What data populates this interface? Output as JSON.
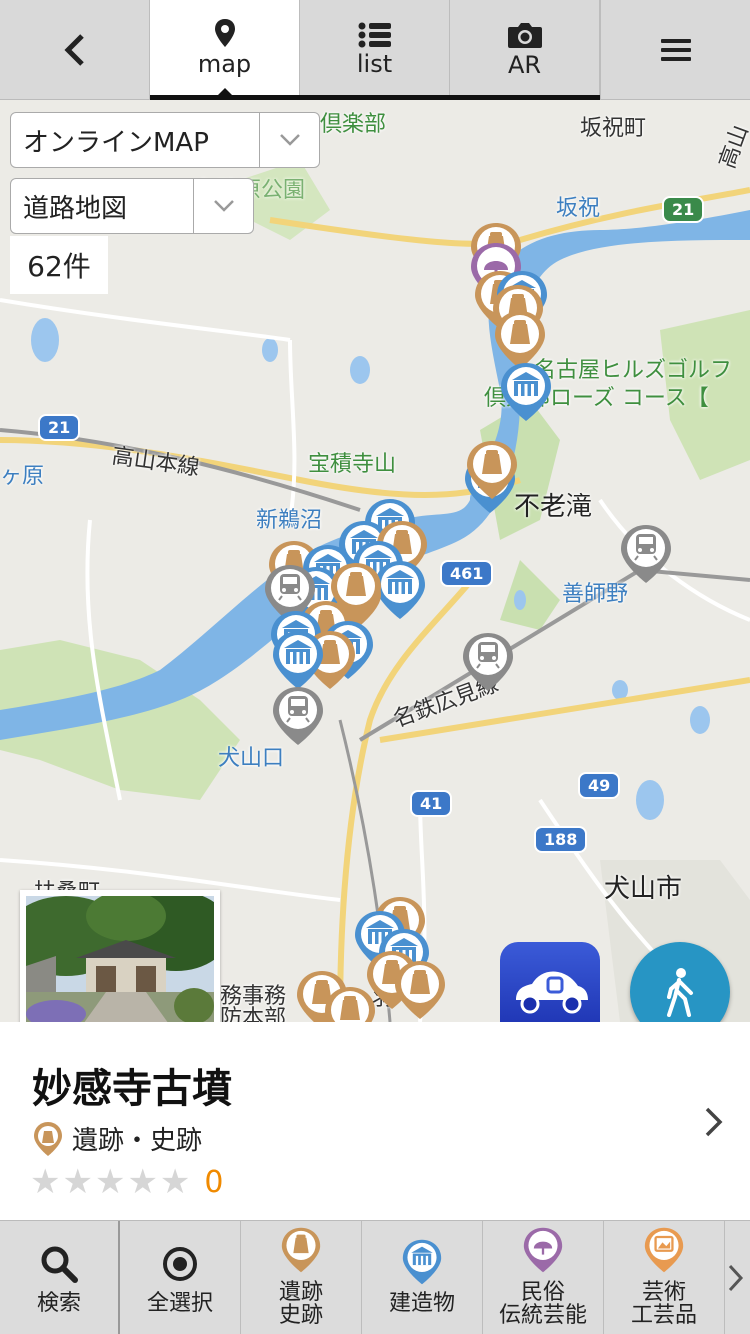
{
  "topbar": {
    "back_icon": "chevron-left-icon",
    "tabs": [
      {
        "label": "map",
        "icon": "map-pin-icon"
      },
      {
        "label": "list",
        "icon": "list-icon"
      },
      {
        "label": "AR",
        "icon": "camera-icon"
      }
    ],
    "menu_icon": "hamburger-menu-icon"
  },
  "controls": {
    "map_type": "オンラインMAP",
    "map_style": "道路地図",
    "count": "62件"
  },
  "map_labels": {
    "club": "倶楽部",
    "sakahogi_town": "坂祝町",
    "sakahogi_station": "坂祝",
    "park": "各務原公園",
    "hills_golf": "名古屋ヒルズゴルフ",
    "rose_course": "倶楽部ローズ コース【",
    "takayama_line": "高山本線",
    "hoshakuji": "宝積寺山",
    "ga_hara": "ヶ原",
    "shin_unuma": "新鵜沼",
    "furotaki": "不老滝",
    "zenjino": "善師野",
    "meitetsu": "名鉄広見線",
    "inuyamaguchi": "犬山口",
    "inuyama_city": "犬山市",
    "fuso": "扶桑町",
    "office": "務事務",
    "honbu": "防本部",
    "hiwa": "羽",
    "takayama_road": "高山"
  },
  "routes": [
    "21",
    "21",
    "461",
    "49",
    "41",
    "188"
  ],
  "card": {
    "title": "妙感寺古墳",
    "category": "遺跡・史跡",
    "stars": "★★★★★",
    "rating": "0"
  },
  "bottom_bar": [
    {
      "label": "検索",
      "icon": "search-icon"
    },
    {
      "label": "全選択",
      "icon": "select-all-icon"
    },
    {
      "label": "遺跡\n史跡",
      "icon": "ruins-pin-icon"
    },
    {
      "label": "建造物",
      "icon": "building-pin-icon"
    },
    {
      "label": "民俗\n伝統芸能",
      "icon": "folk-pin-icon"
    },
    {
      "label": "芸術\n工芸品",
      "icon": "art-pin-icon"
    }
  ],
  "colors": {
    "ruins": "#c8955a",
    "building": "#4a90d0",
    "station": "#8a8a8a",
    "folk": "#9b6aa8",
    "art": "#e89a50",
    "accent": "#f08a00"
  }
}
